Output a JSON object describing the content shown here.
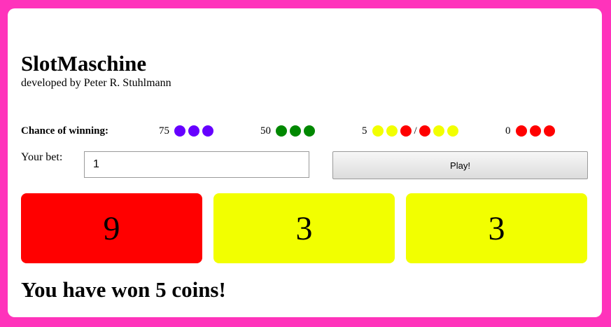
{
  "app": {
    "title": "SlotMaschine",
    "subtitle": "developed by Peter R. Stuhlmann"
  },
  "chances": {
    "label": "Chance of winning:",
    "combos": [
      {
        "value": "75",
        "dots": [
          "#6600ff",
          "#6600ff",
          "#6600ff"
        ]
      },
      {
        "value": "50",
        "dots": [
          "#008800",
          "#008800",
          "#008800"
        ]
      },
      {
        "value": "5",
        "dots": [
          "#f2ff00",
          "#f2ff00",
          "#ff0000"
        ],
        "separator": "/",
        "alt_dots": [
          "#ff0000",
          "#f2ff00",
          "#f2ff00"
        ]
      },
      {
        "value": "0",
        "dots": [
          "#ff0000",
          "#ff0000",
          "#ff0000"
        ]
      }
    ]
  },
  "bet": {
    "label": "Your bet:",
    "value": "1"
  },
  "play_button": {
    "label": "Play!"
  },
  "reels": [
    {
      "number": "9",
      "color": "#ff0000"
    },
    {
      "number": "3",
      "color": "#f2ff00"
    },
    {
      "number": "3",
      "color": "#f2ff00"
    }
  ],
  "result": {
    "message": "You have won 5 coins!"
  },
  "colors": {
    "background": "#ff33bb",
    "card": "#ffffff"
  }
}
